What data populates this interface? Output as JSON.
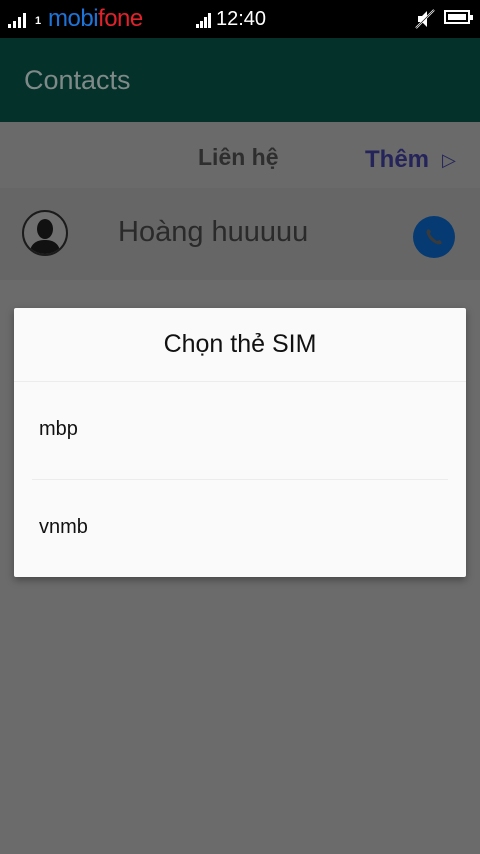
{
  "status_bar": {
    "carrier_part1": "mobi",
    "carrier_part2": "fone",
    "time": "12:40",
    "sim1_index": "1",
    "sim2_index": "",
    "icons": [
      "signal-icon",
      "signal-icon",
      "mute-icon",
      "battery-icon"
    ]
  },
  "app_bar": {
    "title": "Contacts"
  },
  "tabs": {
    "contacts": "Liên hệ",
    "more": "Thêm",
    "more_arrow": "▷"
  },
  "contact": {
    "name": "Hoàng huuuuu",
    "icons": [
      "avatar-icon",
      "phone-icon"
    ]
  },
  "dialog": {
    "title": "Chọn thẻ SIM",
    "options": [
      {
        "label": "mbp"
      },
      {
        "label": "vnmb"
      }
    ]
  },
  "colors": {
    "status_bar_bg": "#000000",
    "app_bar_bg": "#04312a",
    "scrim_bg": "#6b6b6b",
    "dialog_bg": "#fafafa",
    "carrier_blue": "#1e73d8",
    "carrier_red": "#e0222a",
    "call_button": "#063a73"
  }
}
